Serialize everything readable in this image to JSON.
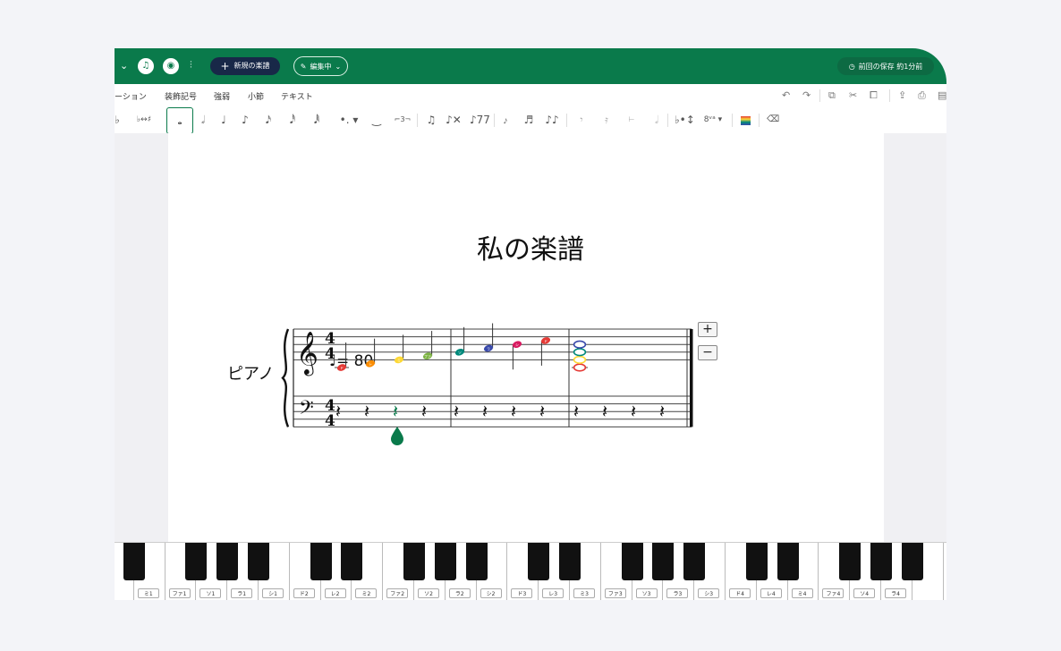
{
  "topbar": {
    "new_score_label": "新規の楽譜",
    "edit_mode_label": "編集中",
    "save_status": "前回の保存 約1分前"
  },
  "menu": {
    "items": [
      "ーション",
      "装飾記号",
      "強弱",
      "小節",
      "テキスト"
    ]
  },
  "score": {
    "title": "私の楽譜",
    "part_name": "ピアノ",
    "tempo_value": "= 80",
    "time_signature": "4/4",
    "treble_notes": [
      {
        "solfege": "ド",
        "color": "#e53935"
      },
      {
        "solfege": "レ",
        "color": "#fb8c00"
      },
      {
        "solfege": "ミ",
        "color": "#fdd835"
      },
      {
        "solfege": "ファ",
        "color": "#7cb342"
      },
      {
        "solfege": "ソ",
        "color": "#00897b"
      },
      {
        "solfege": "ラ",
        "color": "#3949ab"
      },
      {
        "solfege": "シ",
        "color": "#d81b60"
      },
      {
        "solfege": "ド",
        "color": "#e53935"
      }
    ],
    "chord_colors": [
      "#e53935",
      "#fdd835",
      "#00897b",
      "#3949ab"
    ],
    "accent_color": "#0a7a4b"
  },
  "piano": {
    "white_keys": [
      "",
      "ミ1",
      "ファ1",
      "ソ1",
      "ラ1",
      "シ1",
      "ド2",
      "レ2",
      "ミ2",
      "ファ2",
      "ソ2",
      "ラ2",
      "シ2",
      "ド3",
      "レ3",
      "ミ3",
      "ファ3",
      "ソ3",
      "ラ3",
      "シ3",
      "ド4",
      "レ4",
      "ミ4",
      "ファ4",
      "ソ4",
      "ラ4",
      ""
    ]
  }
}
